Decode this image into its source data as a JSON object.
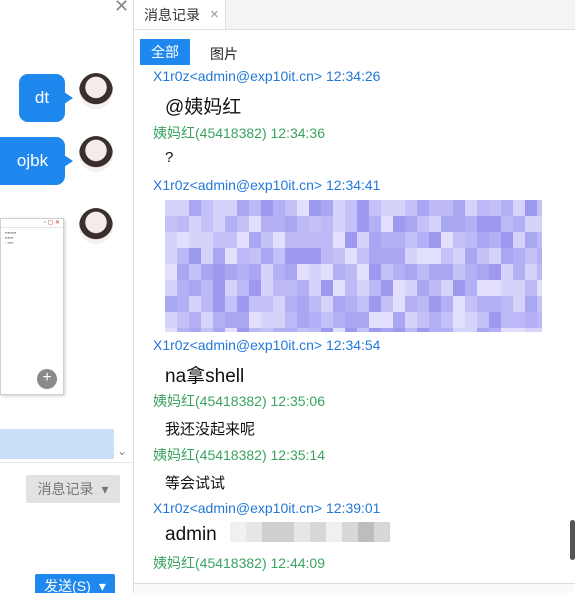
{
  "left": {
    "close_glyph": "✕",
    "bubbles": [
      {
        "text": "dt"
      },
      {
        "text": "ojbk"
      }
    ],
    "zoom_glyph": "+",
    "history_button": {
      "label": "消息记录",
      "arrow": "▾"
    },
    "send_button": {
      "label": "发送(S)",
      "arrow": "▾"
    },
    "scroll_glyph": "⌄"
  },
  "right": {
    "tab": {
      "label": "消息记录",
      "close": "×"
    },
    "filters": {
      "all": "全部",
      "images": "图片"
    },
    "messages": [
      {
        "sender": "X1r0z<admin@exp10it.cn> 12:34:26",
        "content": "@姨妈红"
      },
      {
        "sender": "姨妈红(45418382) 12:34:36",
        "content": "?"
      },
      {
        "sender": "X1r0z<admin@exp10it.cn> 12:34:41",
        "content": ""
      },
      {
        "sender": "X1r0z<admin@exp10it.cn> 12:34:54",
        "content": "na拿shell"
      },
      {
        "sender": "姨妈红(45418382) 12:35:06",
        "content": "我还没起来呢"
      },
      {
        "sender": "姨妈红(45418382) 12:35:14",
        "content": "等会试试"
      },
      {
        "sender": "X1r0z<admin@exp10it.cn> 12:39:01",
        "content": "admin"
      },
      {
        "sender": "姨妈红(45418382) 12:44:09",
        "content": ""
      }
    ]
  },
  "colors": {
    "accent": "#1f88ef",
    "sender_self": "#2478d8",
    "sender_other": "#3aa360",
    "mosaic": "#b9b6f4"
  }
}
